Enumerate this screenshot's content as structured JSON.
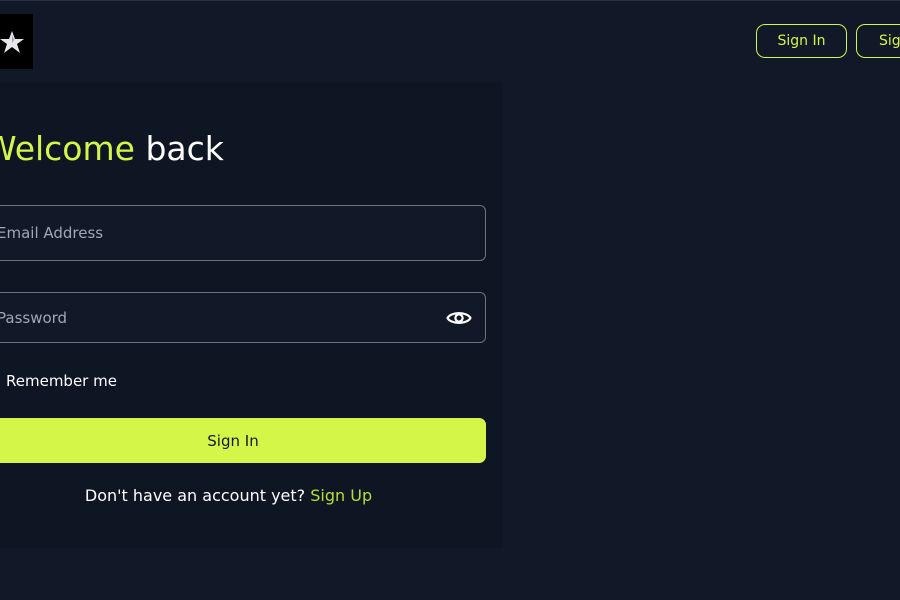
{
  "header": {
    "nav_signin_label": "Sign In",
    "nav_signup_label": "Sign Up"
  },
  "form": {
    "title_accent": "Welcome",
    "title_rest": " back",
    "email_placeholder": "Email Address",
    "email_value": "",
    "password_placeholder": "Password",
    "password_value": "",
    "remember_label": "Remember me",
    "submit_label": "Sign In",
    "signup_prompt": "Don't have an account yet? ",
    "signup_link": "Sign Up"
  },
  "icons": {
    "logo": "star-logo-icon",
    "password_toggle": "eye-icon"
  },
  "colors": {
    "background": "#111827",
    "card": "#0e1523",
    "accent": "#d4f649",
    "link": "#b7dd3a",
    "text": "#ffffff",
    "placeholder": "#a1a7b3"
  }
}
